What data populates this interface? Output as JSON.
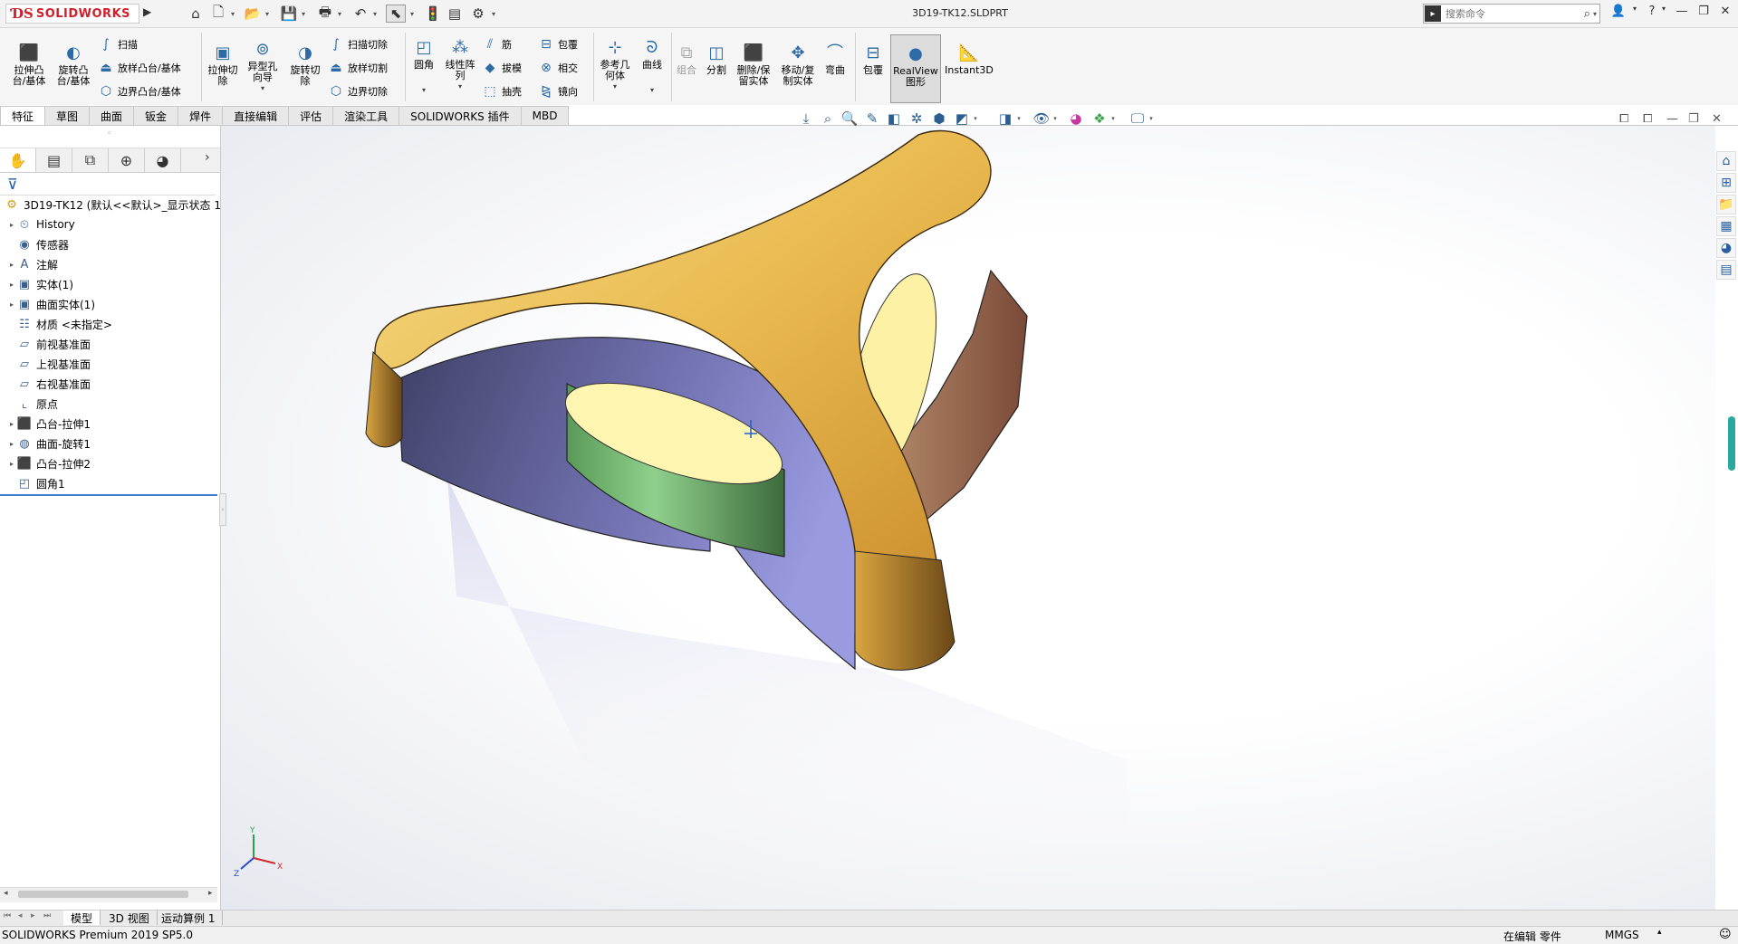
{
  "titlebar": {
    "brand": "SOLIDWORKS",
    "document_title": "3D19-TK12.SLDPRT",
    "search_placeholder": "搜索命令",
    "icons": [
      "home-icon",
      "new-icon",
      "open-icon",
      "save-icon",
      "print-icon",
      "undo-icon",
      "select-icon",
      "rebuild-icon",
      "file-properties-icon",
      "options-icon"
    ]
  },
  "toolbar": {
    "extrude_boss": "拉伸凸\n台/基体",
    "revolve_boss": "旋转凸\n台/基体",
    "sweep": "扫描",
    "loft_boss": "放样凸台/基体",
    "boundary_boss": "边界凸台/基体",
    "extrude_cut": "拉伸切\n除",
    "hole_wizard": "异型孔\n向导",
    "revolve_cut": "旋转切\n除",
    "sweep_cut": "扫描切除",
    "loft_cut": "放样切割",
    "boundary_cut": "边界切除",
    "fillet": "圆角",
    "linear_pattern": "线性阵\n列",
    "rib": "筋",
    "draft": "拔模",
    "shell": "抽壳",
    "wrap": "包覆",
    "intersect": "相交",
    "mirror": "镜向",
    "ref_geometry": "参考几\n何体",
    "curves": "曲线",
    "combine": "组合",
    "split": "分割",
    "delete_keep": "删除/保\n留实体",
    "move_copy": "移动/复\n制实体",
    "flex": "弯曲",
    "wrap2": "包覆",
    "realview": "RealView\n图形",
    "instant3d": "Instant3D"
  },
  "tabs": [
    {
      "label": "特征",
      "active": true
    },
    {
      "label": "草图"
    },
    {
      "label": "曲面"
    },
    {
      "label": "钣金"
    },
    {
      "label": "焊件"
    },
    {
      "label": "直接编辑"
    },
    {
      "label": "评估"
    },
    {
      "label": "渲染工具"
    },
    {
      "label": "SOLIDWORKS 插件"
    },
    {
      "label": "MBD"
    }
  ],
  "tree": {
    "root": "3D19-TK12 (默认<<默认>_显示状态 1",
    "items": [
      {
        "label": "History",
        "icon": "history-icon",
        "expandable": true
      },
      {
        "label": "传感器",
        "icon": "sensor-icon",
        "expandable": false
      },
      {
        "label": "注解",
        "icon": "annotation-icon",
        "expandable": true
      },
      {
        "label": "实体(1)",
        "icon": "solid-bodies-icon",
        "expandable": true
      },
      {
        "label": "曲面实体(1)",
        "icon": "surface-bodies-icon",
        "expandable": true
      },
      {
        "label": "材质 <未指定>",
        "icon": "material-icon",
        "expandable": false
      },
      {
        "label": "前视基准面",
        "icon": "plane-icon",
        "expandable": false
      },
      {
        "label": "上视基准面",
        "icon": "plane-icon",
        "expandable": false
      },
      {
        "label": "右视基准面",
        "icon": "plane-icon",
        "expandable": false
      },
      {
        "label": "原点",
        "icon": "origin-icon",
        "expandable": false
      },
      {
        "label": "凸台-拉伸1",
        "icon": "extrude-icon",
        "expandable": true
      },
      {
        "label": "曲面-旋转1",
        "icon": "revolve-surface-icon",
        "expandable": true
      },
      {
        "label": "凸台-拉伸2",
        "icon": "extrude-icon",
        "expandable": true
      },
      {
        "label": "圆角1",
        "icon": "fillet-icon",
        "expandable": false
      }
    ]
  },
  "bottom_tabs": [
    {
      "label": "模型",
      "active": true
    },
    {
      "label": "3D 视图"
    },
    {
      "label": "运动算例 1"
    }
  ],
  "status": {
    "product": "SOLIDWORKS Premium 2019 SP5.0",
    "editing": "在编辑 零件",
    "units": "MMGS"
  },
  "triad": {
    "x": "X",
    "y": "Y",
    "z": "Z"
  },
  "colors": {
    "brand_red": "#d0202c",
    "model_gold": "#d9a441",
    "face_purple": "#6e6fb0",
    "face_green": "#6fb36e",
    "face_brown": "#8a5c4a",
    "accent_blue": "#3d7cc9"
  }
}
